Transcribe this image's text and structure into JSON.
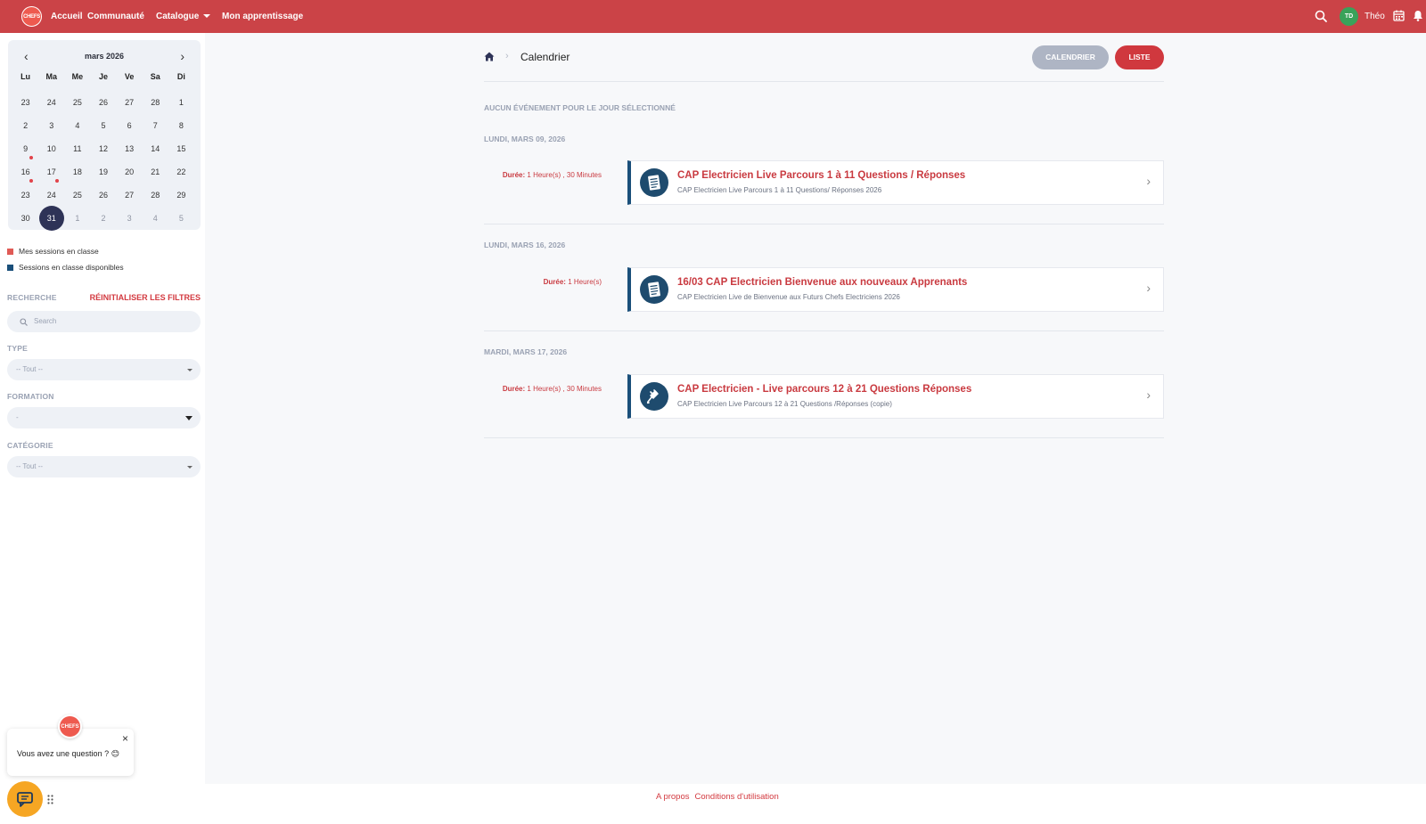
{
  "topbar": {
    "logo_text": "CHEFS",
    "nav": [
      {
        "label": "Accueil"
      },
      {
        "label": "Communauté"
      },
      {
        "label": "Catalogue"
      },
      {
        "label": "Mon apprentissage"
      }
    ],
    "user_initials": "TD",
    "user_name": "Théo",
    "accent": "#cb4347"
  },
  "sidebar": {
    "mini_calendar": {
      "month_label": "mars 2026",
      "weekdays": [
        "Lu",
        "Ma",
        "Me",
        "Je",
        "Ve",
        "Sa",
        "Di"
      ],
      "days": [
        {
          "d": "23",
          "muted": false
        },
        {
          "d": "24",
          "muted": false
        },
        {
          "d": "25",
          "muted": false
        },
        {
          "d": "26",
          "muted": false
        },
        {
          "d": "27",
          "muted": false
        },
        {
          "d": "28",
          "muted": false
        },
        {
          "d": "1",
          "muted": false
        },
        {
          "d": "2",
          "muted": false
        },
        {
          "d": "3",
          "muted": false
        },
        {
          "d": "4",
          "muted": false
        },
        {
          "d": "5",
          "muted": false
        },
        {
          "d": "6",
          "muted": false
        },
        {
          "d": "7",
          "muted": false
        },
        {
          "d": "8",
          "muted": false
        },
        {
          "d": "9",
          "muted": false,
          "dot": true
        },
        {
          "d": "10",
          "muted": false
        },
        {
          "d": "11",
          "muted": false
        },
        {
          "d": "12",
          "muted": false
        },
        {
          "d": "13",
          "muted": false
        },
        {
          "d": "14",
          "muted": false
        },
        {
          "d": "15",
          "muted": false
        },
        {
          "d": "16",
          "muted": false,
          "dot": true
        },
        {
          "d": "17",
          "muted": false,
          "dot": true
        },
        {
          "d": "18",
          "muted": false
        },
        {
          "d": "19",
          "muted": false
        },
        {
          "d": "20",
          "muted": false
        },
        {
          "d": "21",
          "muted": false
        },
        {
          "d": "22",
          "muted": false
        },
        {
          "d": "23",
          "muted": false
        },
        {
          "d": "24",
          "muted": false
        },
        {
          "d": "25",
          "muted": false
        },
        {
          "d": "26",
          "muted": false
        },
        {
          "d": "27",
          "muted": false
        },
        {
          "d": "28",
          "muted": false
        },
        {
          "d": "29",
          "muted": false
        },
        {
          "d": "30",
          "muted": false
        },
        {
          "d": "31",
          "muted": false,
          "selected": true
        },
        {
          "d": "1",
          "muted": true
        },
        {
          "d": "2",
          "muted": true
        },
        {
          "d": "3",
          "muted": true
        },
        {
          "d": "4",
          "muted": true
        },
        {
          "d": "5",
          "muted": true
        }
      ]
    },
    "legend": [
      {
        "label": "Mes sessions en classe",
        "color": "#e05a55"
      },
      {
        "label": "Sessions en classe disponibles",
        "color": "#1a4f7a"
      }
    ],
    "search_label": "RECHERCHE",
    "reset_label": "RÉINITIALISER LES FILTRES",
    "search_placeholder": "Search",
    "type_label": "TYPE",
    "type_value": "-- Tout --",
    "formation_label": "FORMATION",
    "formation_value": "-",
    "category_label": "CATÉGORIE",
    "category_value": "-- Tout --"
  },
  "chat": {
    "message": "Vous avez une question ? 😊",
    "logo_text": "CHEFS"
  },
  "main": {
    "breadcrumb_title": "Calendrier",
    "btn_calendar": "CALENDRIER",
    "btn_list": "LISTE",
    "no_event": "AUCUN ÉVÉNEMENT POUR LE JOUR SÉLECTIONNÉ",
    "days": [
      {
        "heading": "LUNDI, MARS 09, 2026",
        "duration_label": "Durée:",
        "duration_value": "1 Heure(s) , 30 Minutes",
        "title": "CAP Electricien Live Parcours 1 à 11 Questions / Réponses",
        "subtitle": "CAP Electricien Live Parcours 1 à 11 Questions/ Réponses 2026",
        "icon": "checklist-icon"
      },
      {
        "heading": "LUNDI, MARS 16, 2026",
        "duration_label": "Durée:",
        "duration_value": "1 Heure(s)",
        "title": "16/03 CAP Electricien Bienvenue aux nouveaux Apprenants",
        "subtitle": "CAP Electricien Live de Bienvenue aux Futurs Chefs Electriciens 2026",
        "icon": "checklist-icon"
      },
      {
        "heading": "MARDI, MARS 17, 2026",
        "duration_label": "Durée:",
        "duration_value": "1 Heure(s) , 30 Minutes",
        "title": "CAP Electricien - Live parcours 12 à 21 Questions Réponses",
        "subtitle": "CAP Electricien Live Parcours 12 à 21 Questions /Réponses (copie)",
        "icon": "plug-icon"
      }
    ]
  },
  "footer": {
    "about": "A propos",
    "terms": "Conditions d'utilisation"
  }
}
